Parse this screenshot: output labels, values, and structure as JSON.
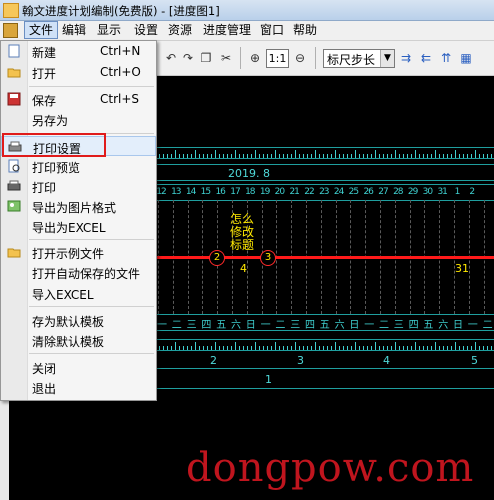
{
  "window": {
    "title": "翰文进度计划编制(免费版) - [进度图1]"
  },
  "menubar": {
    "items": [
      {
        "label": "文件",
        "active": true
      },
      {
        "label": "编辑"
      },
      {
        "label": "显示"
      },
      {
        "label": "设置"
      },
      {
        "label": "资源"
      },
      {
        "label": "进度管理"
      },
      {
        "label": "窗口"
      },
      {
        "label": "帮助"
      }
    ]
  },
  "toolbar": {
    "zoom_label": "1:1",
    "step_combo_value": "标尺步长",
    "icons": [
      "undo-icon",
      "redo-icon",
      "copy-icon",
      "paste-icon",
      "zoom-in-icon",
      "zoom-out-icon",
      "arrow-right-icon",
      "arrow-left-icon",
      "arrow-up-icon",
      "layout-icon"
    ]
  },
  "file_menu": {
    "items": [
      {
        "label": "新建",
        "shortcut": "Ctrl+N",
        "icon": "new-doc-icon"
      },
      {
        "label": "打开",
        "shortcut": "Ctrl+O",
        "icon": "folder-open-icon"
      },
      {
        "label": "保存",
        "shortcut": "Ctrl+S",
        "icon": "save-icon"
      },
      {
        "label": "另存为",
        "shortcut": ""
      },
      {
        "label": "打印设置",
        "shortcut": "",
        "icon": "printer-setup-icon",
        "highlighted": true
      },
      {
        "label": "打印预览",
        "shortcut": "",
        "icon": "print-preview-icon"
      },
      {
        "label": "打印",
        "shortcut": "",
        "icon": "printer-icon"
      },
      {
        "label": "导出为图片格式",
        "shortcut": "",
        "icon": "image-export-icon"
      },
      {
        "label": "导出为EXCEL",
        "shortcut": ""
      },
      {
        "label": "打开示例文件",
        "shortcut": "",
        "icon": "folder-example-icon"
      },
      {
        "label": "打开自动保存的文件",
        "shortcut": ""
      },
      {
        "label": "导入EXCEL",
        "shortcut": ""
      },
      {
        "label": "存为默认模板",
        "shortcut": ""
      },
      {
        "label": "清除默认模板",
        "shortcut": ""
      },
      {
        "label": "关闭",
        "shortcut": ""
      },
      {
        "label": "退出",
        "shortcut": ""
      }
    ]
  },
  "chart": {
    "month_label": "2019. 8",
    "day_numbers": [
      "12",
      "13",
      "14",
      "15",
      "16",
      "17",
      "18",
      "19",
      "20",
      "21",
      "22",
      "23",
      "24",
      "25",
      "26",
      "27",
      "28",
      "29",
      "30",
      "31",
      "1",
      "2"
    ],
    "weekday_labels": [
      "一",
      "二",
      "三",
      "四",
      "五",
      "六",
      "日",
      "一",
      "二",
      "三",
      "四",
      "五",
      "六",
      "日",
      "一",
      "二",
      "三",
      "四",
      "五",
      "六",
      "日",
      "一",
      "二"
    ],
    "nodes": [
      {
        "label": "2"
      },
      {
        "label": "3"
      }
    ],
    "task_durations": {
      "task_a": "4",
      "task_b": "31"
    },
    "annotation": "怎么修改标题",
    "bottom_row1": [
      "2",
      "3",
      "4",
      "5"
    ],
    "bottom_row2": [
      "1"
    ]
  },
  "watermark": "dongpow.com",
  "colors": {
    "canvas": "#000000",
    "grid_cyan": "#3fd0d0",
    "task_line": "#ff1a1a",
    "label_yellow": "#ffe800",
    "highlight_box": "#e01b1b"
  }
}
